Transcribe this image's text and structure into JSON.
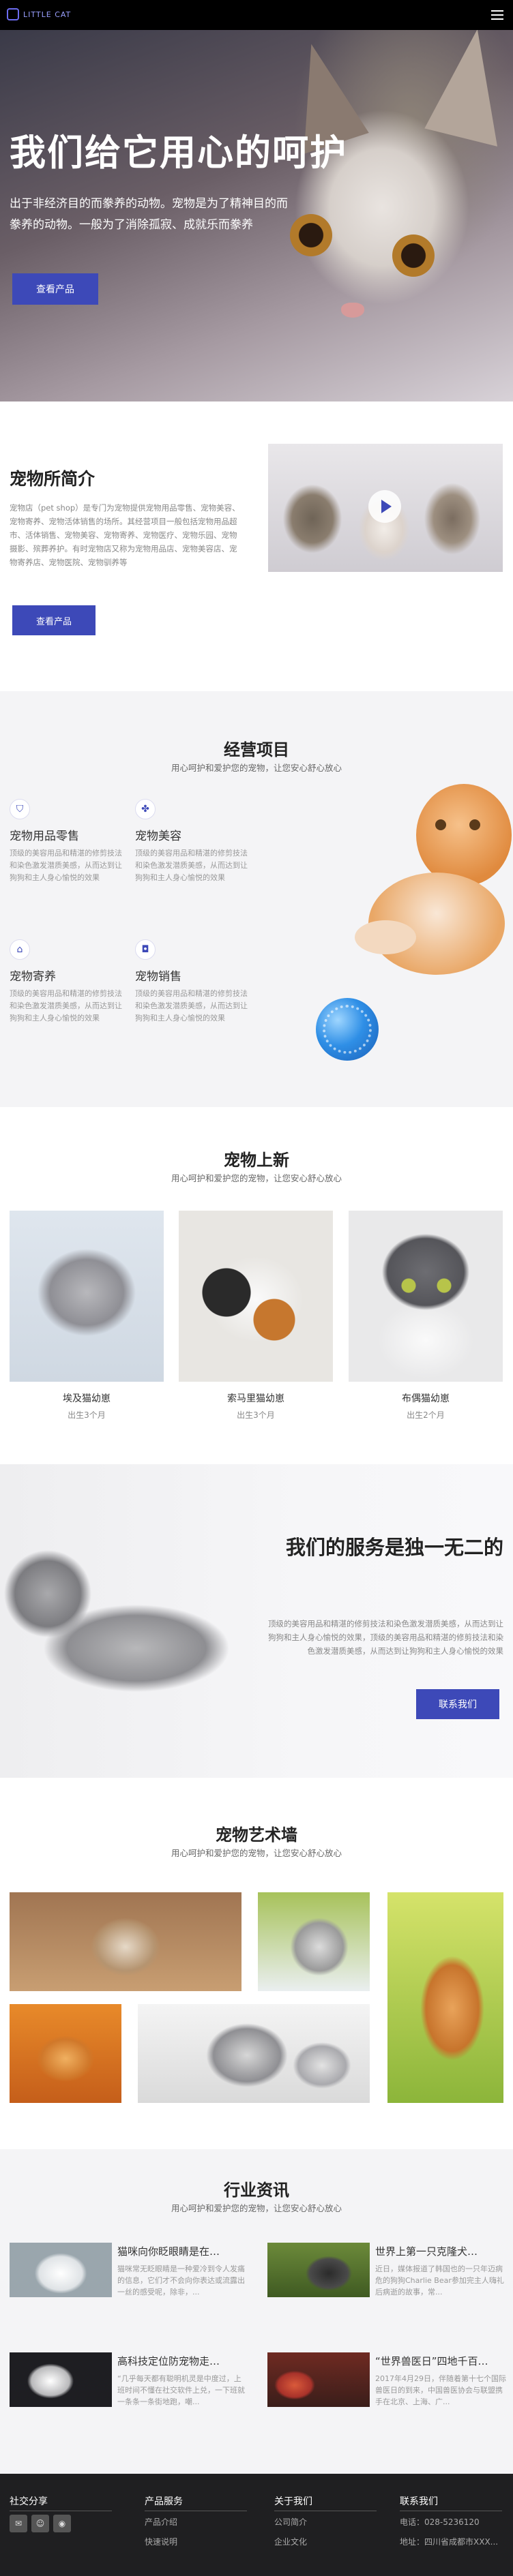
{
  "nav": {
    "logo_text": "LITTLE CAT"
  },
  "hero": {
    "title": "我们给它用心的呵护",
    "description": "出于非经济目的而豢养的动物。宠物是为了精神目的而豢养的动物。一般为了消除孤寂、成就乐而豢养",
    "button": "查看产品"
  },
  "intro": {
    "title": "宠物所简介",
    "text": "宠物店（pet shop）是专门为宠物提供宠物用品零售、宠物美容、宠物寄养、宠物活体销售的场所。其经营项目一般包括宠物用品超市、活体销售、宠物美容、宠物寄养、宠物医疗、宠物乐园、宠物摄影、殡葬养护。有时宠物店又称为宠物用品店、宠物美容店、宠物寄养店、宠物医院、宠物驯养等",
    "button": "查看产品"
  },
  "business": {
    "title": "经营项目",
    "subtitle": "用心呵护和爱护您的宠物，让您安心舒心放心",
    "items": [
      {
        "icon": "shield-icon",
        "name": "宠物用品零售",
        "desc": "顶级的美容用品和精湛的修剪技法和染色激发潜质美感，从而达到让狗狗和主人身心愉悦的效果"
      },
      {
        "icon": "paw-icon",
        "name": "宠物美容",
        "desc": "顶级的美容用品和精湛的修剪技法和染色激发潜质美感，从而达到让狗狗和主人身心愉悦的效果"
      },
      {
        "icon": "home-icon",
        "name": "宠物寄养",
        "desc": "顶级的美容用品和精湛的修剪技法和染色激发潜质美感，从而达到让狗狗和主人身心愉悦的效果"
      },
      {
        "icon": "bag-icon",
        "name": "宠物销售",
        "desc": "顶级的美容用品和精湛的修剪技法和染色激发潜质美感，从而达到让狗狗和主人身心愉悦的效果"
      }
    ]
  },
  "newpets": {
    "title": "宠物上新",
    "subtitle": "用心呵护和爱护您的宠物，让您安心舒心放心",
    "items": [
      {
        "name": "埃及猫幼崽",
        "age": "出生3个月"
      },
      {
        "name": "索马里猫幼崽",
        "age": "出生3个月"
      },
      {
        "name": "布偶猫幼崽",
        "age": "出生2个月"
      }
    ]
  },
  "service": {
    "title": "我们的服务是独一无二的",
    "desc": "顶级的美容用品和精湛的修剪技法和染色激发潜质美感，从而达到让狗狗和主人身心愉悦的效果，顶级的美容用品和精湛的修剪技法和染色激发潜质美感，从而达到让狗狗和主人身心愉悦的效果",
    "button": "联系我们"
  },
  "gallery": {
    "title": "宠物艺术墙",
    "subtitle": "用心呵护和爱护您的宠物，让您安心舒心放心"
  },
  "news": {
    "title": "行业资讯",
    "subtitle": "用心呵护和爱护您的宠物，让您安心舒心放心",
    "items": [
      {
        "title": "猫咪向你眨眼睛是在…",
        "desc": "猫咪常无眨眼睛是一种爱冷到令人发痛的信息，它们才不会向你表达或流露出一丝的感受呢，除非，..."
      },
      {
        "title": "世界上第一只克隆犬…",
        "desc": "近日，媒体报道了韩国也的一只年迈病危的狗狗Charlie Bear参加完主人嗨礼后病逝的故事，常..."
      },
      {
        "title": "高科技定位防宠物走…",
        "desc": "“几乎每天都有聪明机灵是中度过，上班时间不懂在社交软件上兑，一下班就一条条一条街地跑，嘲..."
      },
      {
        "title": "“世界兽医日”四地千百…",
        "desc": "2017年4月29日，伴随着第十七个国际兽医日的到来，中国兽医协会与联盟携手在北京、上海、广..."
      }
    ]
  },
  "footer": {
    "share_title": "社交分享",
    "col2": {
      "title": "产品服务",
      "links": [
        "产品介绍",
        "快速说明"
      ]
    },
    "col3": {
      "title": "关于我们",
      "links": [
        "公司简介",
        "企业文化"
      ]
    },
    "col4": {
      "title": "联系我们",
      "links": [
        "电话：028-5236120",
        "地址：四川省成都市XXX..."
      ]
    },
    "icons": [
      "wechat-icon",
      "qq-icon",
      "weibo-icon"
    ]
  }
}
